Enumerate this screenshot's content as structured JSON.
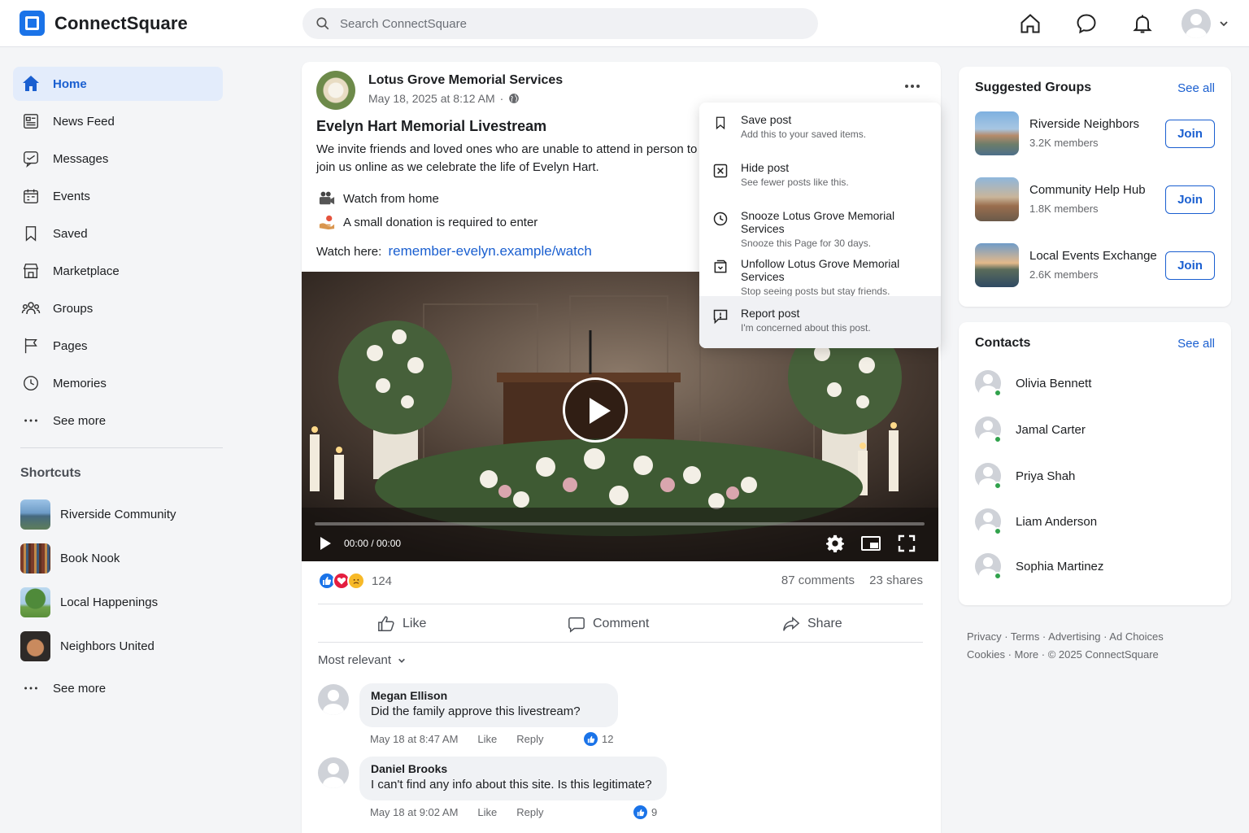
{
  "app": {
    "name": "ConnectSquare"
  },
  "search": {
    "placeholder": "Search ConnectSquare"
  },
  "sidebar": {
    "items": [
      {
        "label": "Home",
        "icon": "home-icon",
        "active": true
      },
      {
        "label": "News Feed",
        "icon": "news-feed-icon"
      },
      {
        "label": "Messages",
        "icon": "messages-icon"
      },
      {
        "label": "Events",
        "icon": "calendar-icon"
      },
      {
        "label": "Saved",
        "icon": "bookmark-icon"
      },
      {
        "label": "Marketplace",
        "icon": "store-icon"
      },
      {
        "label": "Groups",
        "icon": "groups-icon"
      },
      {
        "label": "Pages",
        "icon": "flag-icon"
      },
      {
        "label": "Memories",
        "icon": "clock-icon"
      },
      {
        "label": "See more",
        "icon": "more-dots-icon"
      }
    ],
    "shortcuts_title": "Shortcuts",
    "shortcuts": [
      {
        "label": "Riverside Community"
      },
      {
        "label": "Book Nook"
      },
      {
        "label": "Local Happenings"
      },
      {
        "label": "Neighbors United"
      }
    ],
    "shortcuts_more": "See more"
  },
  "post": {
    "page_name": "Lotus Grove Memorial Services",
    "date": "May 18, 2025 at 8:12 AM",
    "title": "Evelyn Hart Memorial Livestream",
    "body": "We invite friends and loved ones who are unable to attend in person to join us online as we celebrate the life of Evelyn Hart.",
    "bullets": [
      {
        "icon": "video-camera-icon",
        "text": "Watch from home"
      },
      {
        "icon": "donation-hand-icon",
        "text": "A small donation is required to enter"
      }
    ],
    "watch_label": "Watch here:",
    "watch_link": "remember-evelyn.example/watch",
    "video_time": "00:00 / 00:00",
    "video_progress": 0,
    "reaction_count": "124",
    "comments_count": "87 comments",
    "shares_count": "23 shares",
    "actions": {
      "like": "Like",
      "comment": "Comment",
      "share": "Share"
    },
    "sort_label": "Most relevant",
    "comments": [
      {
        "name": "Megan Ellison",
        "text": "Did the family approve this livestream?",
        "time": "May 18 at 8:47 AM",
        "like": "Like",
        "reply": "Reply",
        "likes": "12"
      },
      {
        "name": "Daniel Brooks",
        "text": "I can't find any info about this site. Is this legitimate?",
        "time": "May 18 at 9:02 AM",
        "like": "Like",
        "reply": "Reply",
        "likes": "9"
      }
    ]
  },
  "menu": {
    "items": [
      {
        "title": "Save post",
        "sub": "Add this to your saved items.",
        "icon": "bookmark-icon"
      },
      {
        "title": "Hide post",
        "sub": "See fewer posts like this.",
        "icon": "hide-box-icon"
      },
      {
        "title": "Snooze Lotus Grove Memorial Services",
        "sub": "Snooze this Page for 30 days.",
        "icon": "clock-icon"
      },
      {
        "title": "Unfollow Lotus Grove Memorial Services",
        "sub": "Stop seeing posts but stay friends.",
        "icon": "unfollow-icon"
      },
      {
        "title": "Report post",
        "sub": "I'm concerned about this post.",
        "icon": "report-icon",
        "highlighted": true
      }
    ]
  },
  "groups": {
    "title": "Suggested Groups",
    "see_all": "See all",
    "items": [
      {
        "name": "Riverside Neighbors",
        "members": "3.2K members",
        "join": "Join"
      },
      {
        "name": "Community Help Hub",
        "members": "1.8K members",
        "join": "Join"
      },
      {
        "name": "Local Events Exchange",
        "members": "2.6K members",
        "join": "Join"
      }
    ]
  },
  "contacts": {
    "title": "Contacts",
    "see_all": "See all",
    "items": [
      {
        "name": "Olivia Bennett",
        "online": true
      },
      {
        "name": "Jamal Carter",
        "online": true
      },
      {
        "name": "Priya Shah",
        "online": true
      },
      {
        "name": "Liam Anderson",
        "online": true
      },
      {
        "name": "Sophia Martinez",
        "online": true
      }
    ]
  },
  "footer": {
    "line1": "Privacy · Terms · Advertising · Ad Choices",
    "line2": "Cookies · More · © 2025 ConnectSquare"
  },
  "colors": {
    "accent": "#1a5fd0",
    "active_bg": "#e3ecfb",
    "online": "#31a24c"
  }
}
